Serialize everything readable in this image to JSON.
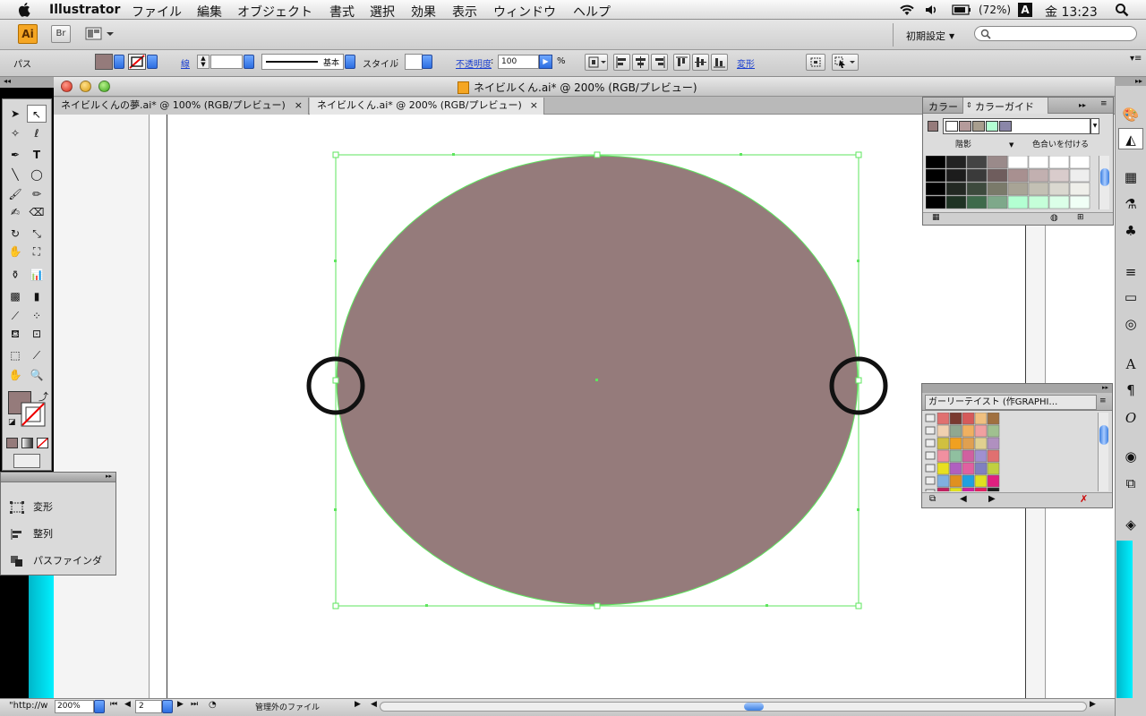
{
  "menubar": {
    "app_name": "Illustrator",
    "menus": [
      "ファイル",
      "編集",
      "オブジェクト",
      "書式",
      "選択",
      "効果",
      "表示",
      "ウィンドウ",
      "ヘルプ"
    ],
    "battery": "(72%)",
    "input_method": "A",
    "clock": "金 13:23"
  },
  "appbar": {
    "logo": "Ai",
    "bridge_button": "Br",
    "workspace": "初期設定"
  },
  "control_bar": {
    "path_label": "パス",
    "stroke_label": "線",
    "stroke_style": "基本",
    "style_label": "スタイル",
    "opacity_label": "不透明度",
    "opacity_value": "100",
    "percent": "%",
    "transform_label": "変形"
  },
  "document": {
    "window_title": "ネイビルくん.ai* @ 200% (RGB/プレビュー)",
    "tabs": [
      {
        "label": "ネイビルくんの夢.ai* @ 100% (RGB/プレビュー)"
      },
      {
        "label": "ネイビルくん.ai* @ 200% (RGB/プレビュー)"
      }
    ],
    "tab_close": "×",
    "fill_color": "#957b7b",
    "selection_color": "#5ee65e"
  },
  "floating_panel": {
    "items": [
      {
        "label": "変形"
      },
      {
        "label": "整列"
      },
      {
        "label": "パスファインダ"
      }
    ]
  },
  "color_panel": {
    "tab_color": "カラー",
    "tab_guide": "カラーガイド",
    "shade_label": "階影",
    "colorize_label": "色合いを付ける",
    "harmony_colors": [
      "#ffffff",
      "#b59b9b",
      "#a89e8e",
      "#b3ffd2",
      "#8a86a8"
    ]
  },
  "swatch_panel": {
    "title": "ガーリーテイスト (作GRAPHI…"
  },
  "status_bar": {
    "url_fragment": "\"http://w",
    "zoom": "200%",
    "page": "2",
    "status_text": "管理外のファイル"
  }
}
